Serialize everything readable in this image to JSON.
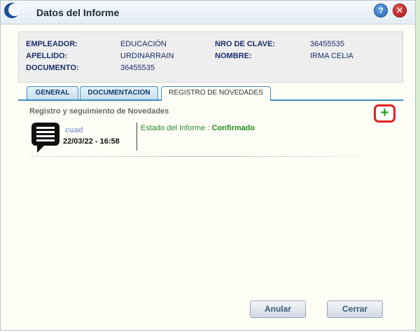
{
  "dialog": {
    "title": "Datos del Informe",
    "help_glyph": "?",
    "close_glyph": "✕"
  },
  "info": {
    "empleador_label": "EMPLEADOR:",
    "empleador_value": "EDUCACIÓN",
    "nro_clave_label": "NRO DE CLAVE:",
    "nro_clave_value": "36455535",
    "apellido_label": "APELLIDO:",
    "apellido_value": "URDINARRAIN",
    "nombre_label": "NOMBRE:",
    "nombre_value": "IRMA CELIA",
    "documento_label": "DOCUMENTO:",
    "documento_value": "36455535"
  },
  "tabs": [
    {
      "label": "GENERAL",
      "active": false
    },
    {
      "label": "DOCUMENTACION",
      "active": false
    },
    {
      "label": "REGISTRO DE NOVEDADES",
      "active": true
    }
  ],
  "section": {
    "title": "Registro y seguimiento de Novedades",
    "add_glyph": "+"
  },
  "entries": [
    {
      "user": "cuad",
      "datetime": "22/03/22 - 16:58",
      "status_label": "Estado del Informe : ",
      "status_value": "Confirmado"
    }
  ],
  "buttons": {
    "anular": "Anular",
    "cerrar": "Cerrar"
  },
  "icons": {
    "app_logo": "app-logo-icon",
    "help": "help-icon",
    "close": "close-icon",
    "add": "plus-icon",
    "entry": "chat-bubble-icon"
  },
  "colors": {
    "tab_accent": "#3d8fc4",
    "add_border": "#e02020",
    "add_plus": "#20a020",
    "status": "#1f8f1f"
  }
}
